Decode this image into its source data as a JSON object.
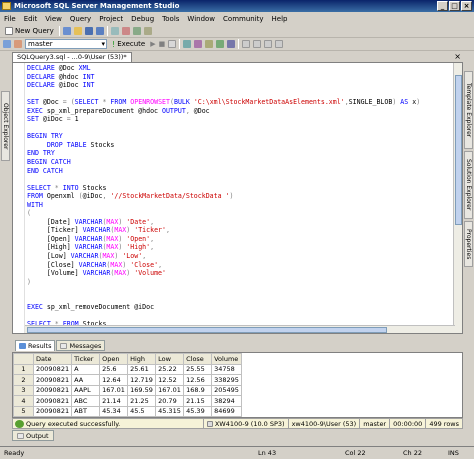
{
  "window": {
    "title": "Microsoft SQL Server Management Studio"
  },
  "menu": [
    "File",
    "Edit",
    "View",
    "Query",
    "Project",
    "Debug",
    "Tools",
    "Window",
    "Community",
    "Help"
  ],
  "toolbar": {
    "new_query": "New Query",
    "database": "master",
    "execute": "Execute"
  },
  "left_panel": {
    "label": "Object Explorer"
  },
  "right_panels": [
    "Template Explorer",
    "Solution Explorer",
    "Properties"
  ],
  "document_tab": {
    "label": "SQLQuery3.sql - ...0-9\\User (53))*"
  },
  "code_lines": [
    [
      [
        "kw",
        "DECLARE "
      ],
      [
        "var",
        "@Doc "
      ],
      [
        "kw",
        "XML"
      ]
    ],
    [
      [
        "kw",
        "DECLARE "
      ],
      [
        "var",
        "@hdoc "
      ],
      [
        "kw",
        "INT"
      ]
    ],
    [
      [
        "kw",
        "DECLARE "
      ],
      [
        "var",
        "@iDoc "
      ],
      [
        "kw",
        "INT"
      ]
    ],
    [],
    [
      [
        "kw",
        "SET "
      ],
      [
        "var",
        "@Doc "
      ],
      [
        "gr",
        "= ("
      ],
      [
        "kw",
        "SELECT "
      ],
      [
        "gr",
        "* "
      ],
      [
        "kw",
        "FROM "
      ],
      [
        "fn",
        "OPENROWSET"
      ],
      [
        "gr",
        "("
      ],
      [
        "kw",
        "BULK "
      ],
      [
        "st",
        "'C:\\xml\\StockMarketDataAsElements.xml'"
      ],
      [
        "gr",
        ","
      ],
      [
        "var",
        "SINGLE_BLOB"
      ],
      [
        "gr",
        ") "
      ],
      [
        "kw",
        "AS "
      ],
      [
        "var",
        "x"
      ],
      [
        "gr",
        ")"
      ]
    ],
    [
      [
        "kw",
        "EXEC "
      ],
      [
        "var",
        "sp_xml_prepareDocument @hdoc "
      ],
      [
        "kw",
        "OUTPUT"
      ],
      [
        "gr",
        ", "
      ],
      [
        "var",
        "@Doc"
      ]
    ],
    [
      [
        "kw",
        "SET "
      ],
      [
        "var",
        "@iDoc "
      ],
      [
        "gr",
        "= "
      ],
      [
        "var",
        "1"
      ]
    ],
    [],
    [
      [
        "kw",
        "BEGIN TRY"
      ]
    ],
    [
      [
        "var",
        "     "
      ],
      [
        "kw",
        "DROP TABLE "
      ],
      [
        "var",
        "Stocks"
      ]
    ],
    [
      [
        "kw",
        "END TRY"
      ]
    ],
    [
      [
        "kw",
        "BEGIN CATCH"
      ]
    ],
    [
      [
        "kw",
        "END CATCH"
      ]
    ],
    [],
    [
      [
        "kw",
        "SELECT "
      ],
      [
        "gr",
        "* "
      ],
      [
        "kw",
        "INTO "
      ],
      [
        "var",
        "Stocks"
      ]
    ],
    [
      [
        "kw",
        "FROM "
      ],
      [
        "var",
        "Openxml "
      ],
      [
        "gr",
        "("
      ],
      [
        "var",
        "@iDoc"
      ],
      [
        "gr",
        ", "
      ],
      [
        "st",
        "'//StockMarketData/StockData '"
      ],
      [
        "gr",
        ")"
      ]
    ],
    [
      [
        "kw",
        "WITH"
      ]
    ],
    [
      [
        "gr",
        "("
      ]
    ],
    [
      [
        "var",
        "     [Date] "
      ],
      [
        "kw",
        "VARCHAR"
      ],
      [
        "gr",
        "("
      ],
      [
        "fn",
        "MAX"
      ],
      [
        "gr",
        ") "
      ],
      [
        "st",
        "'Date'"
      ],
      [
        "gr",
        ","
      ]
    ],
    [
      [
        "var",
        "     [Ticker] "
      ],
      [
        "kw",
        "VARCHAR"
      ],
      [
        "gr",
        "("
      ],
      [
        "fn",
        "MAX"
      ],
      [
        "gr",
        ") "
      ],
      [
        "st",
        "'Ticker'"
      ],
      [
        "gr",
        ","
      ]
    ],
    [
      [
        "var",
        "     [Open] "
      ],
      [
        "kw",
        "VARCHAR"
      ],
      [
        "gr",
        "("
      ],
      [
        "fn",
        "MAX"
      ],
      [
        "gr",
        ") "
      ],
      [
        "st",
        "'Open'"
      ],
      [
        "gr",
        ","
      ]
    ],
    [
      [
        "var",
        "     [High] "
      ],
      [
        "kw",
        "VARCHAR"
      ],
      [
        "gr",
        "("
      ],
      [
        "fn",
        "MAX"
      ],
      [
        "gr",
        ") "
      ],
      [
        "st",
        "'High'"
      ],
      [
        "gr",
        ","
      ]
    ],
    [
      [
        "var",
        "     [Low] "
      ],
      [
        "kw",
        "VARCHAR"
      ],
      [
        "gr",
        "("
      ],
      [
        "fn",
        "MAX"
      ],
      [
        "gr",
        ") "
      ],
      [
        "st",
        "'Low'"
      ],
      [
        "gr",
        ","
      ]
    ],
    [
      [
        "var",
        "     [Close] "
      ],
      [
        "kw",
        "VARCHAR"
      ],
      [
        "gr",
        "("
      ],
      [
        "fn",
        "MAX"
      ],
      [
        "gr",
        ") "
      ],
      [
        "st",
        "'Close'"
      ],
      [
        "gr",
        ","
      ]
    ],
    [
      [
        "var",
        "     [Volume] "
      ],
      [
        "kw",
        "VARCHAR"
      ],
      [
        "gr",
        "("
      ],
      [
        "fn",
        "MAX"
      ],
      [
        "gr",
        ") "
      ],
      [
        "st",
        "'Volume'"
      ]
    ],
    [
      [
        "gr",
        ")"
      ]
    ],
    [],
    [],
    [
      [
        "kw",
        "EXEC "
      ],
      [
        "var",
        "sp_xml_removeDocument @iDoc"
      ]
    ],
    [],
    [
      [
        "kw",
        "SELECT "
      ],
      [
        "gr",
        "* "
      ],
      [
        "kw",
        "FROM "
      ],
      [
        "var",
        "Stocks"
      ]
    ]
  ],
  "result_tabs": [
    "Results",
    "Messages"
  ],
  "results": {
    "columns": [
      "Date",
      "Ticker",
      "Open",
      "High",
      "Low",
      "Close",
      "Volume"
    ],
    "rows": [
      [
        "1",
        "20090821",
        "A",
        "25.6",
        "25.61",
        "25.22",
        "25.55",
        "34758"
      ],
      [
        "2",
        "20090821",
        "AA",
        "12.64",
        "12.719",
        "12.52",
        "12.56",
        "338295"
      ],
      [
        "3",
        "20090821",
        "AAPL",
        "167.01",
        "169.59",
        "167.01",
        "168.9",
        "205495"
      ],
      [
        "4",
        "20090821",
        "ABC",
        "21.14",
        "21.25",
        "20.79",
        "21.15",
        "38294"
      ],
      [
        "5",
        "20090821",
        "ABT",
        "45.34",
        "45.5",
        "45.315",
        "45.39",
        "84699"
      ],
      [
        "6",
        "20090821",
        "ACE",
        "50.95",
        "51.59",
        "50.44",
        "51.03",
        "22931"
      ]
    ]
  },
  "status": {
    "message": "Query executed successfully.",
    "server": "XW4100-9 (10.0 SP3)",
    "user": "xw4100-9\\User (53)",
    "database": "master",
    "elapsed": "00:00:00",
    "rows": "499 rows"
  },
  "output_tab": "Output",
  "app_status": {
    "ready": "Ready",
    "ln": "Ln 43",
    "col": "Col 22",
    "ch": "Ch 22",
    "ins": "INS"
  }
}
